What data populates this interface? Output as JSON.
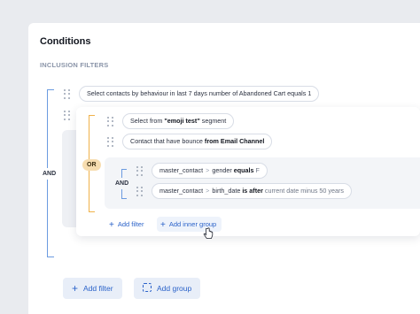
{
  "title": "Conditions",
  "section_label": "INCLUSION FILTERS",
  "root_operator": "AND",
  "top_filter": {
    "prefix": "Select contacts by behaviour in last 7 days number of Abandoned Cart equals 1"
  },
  "group": {
    "operator": "OR",
    "filters": [
      {
        "pre": "Select from ",
        "bold": "\"emoji test\"",
        "post": " segment"
      },
      {
        "pre": "Contact that have bounce ",
        "bold": "from",
        "post": " Email Channel"
      }
    ],
    "inner_group": {
      "operator": "AND",
      "filters": [
        {
          "field": "master_contact",
          "sep": ">",
          "attr": "gender",
          "op": "equals",
          "value": "F"
        },
        {
          "field": "master_contact",
          "sep": ">",
          "attr": "birth_date",
          "op": "is after",
          "value": "current date minus 50 years"
        }
      ]
    },
    "add_filter_label": "Add filter",
    "add_inner_group_label": "Add inner group"
  },
  "footer": {
    "add_filter_label": "Add filter",
    "add_group_label": "Add group"
  },
  "colors": {
    "accent": "#2a62c9",
    "bracket": "#6b9be0",
    "or_bracket": "#f0b24a"
  }
}
